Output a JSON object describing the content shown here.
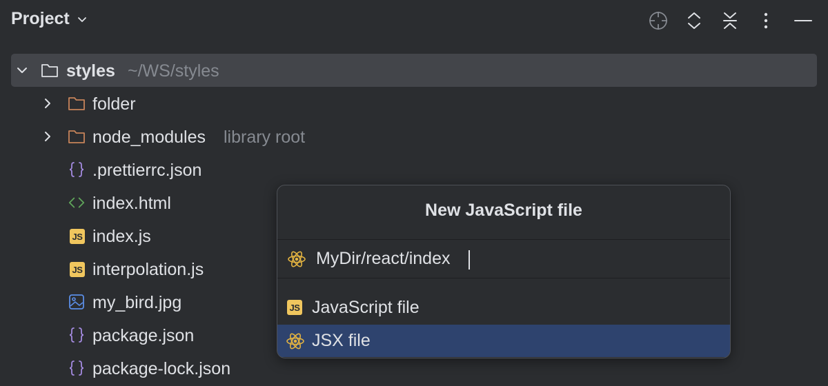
{
  "header": {
    "title": "Project"
  },
  "toolbar": {
    "items": [
      "locate-icon",
      "expand-collapse-icon",
      "collapse-all-icon",
      "more-options-icon",
      "hide-icon"
    ]
  },
  "tree": {
    "root": {
      "name": "styles",
      "path": "~/WS/styles"
    },
    "items": [
      {
        "name": "folder",
        "type": "folder",
        "hint": ""
      },
      {
        "name": "node_modules",
        "type": "folder",
        "hint": "library root"
      },
      {
        "name": ".prettierrc.json",
        "type": "json"
      },
      {
        "name": "index.html",
        "type": "html"
      },
      {
        "name": "index.js",
        "type": "js"
      },
      {
        "name": "interpolation.js",
        "type": "js"
      },
      {
        "name": "my_bird.jpg",
        "type": "image"
      },
      {
        "name": "package.json",
        "type": "json"
      },
      {
        "name": "package-lock.json",
        "type": "json"
      }
    ]
  },
  "popup": {
    "title": "New JavaScript file",
    "input_value": "MyDir/react/index",
    "options": [
      {
        "label": "JavaScript file",
        "icon": "js-file-icon",
        "selected": false
      },
      {
        "label": "JSX file",
        "icon": "react-icon",
        "selected": true
      }
    ]
  },
  "colors": {
    "background": "#2b2d30",
    "selection": "#2e436e",
    "root_highlight": "#43454a",
    "js_badge": "#f0c65e",
    "folder": "#c7845a",
    "json": "#a48be0",
    "html": "#5fa55a",
    "image": "#5b8ee6",
    "react": "#e3b341"
  }
}
